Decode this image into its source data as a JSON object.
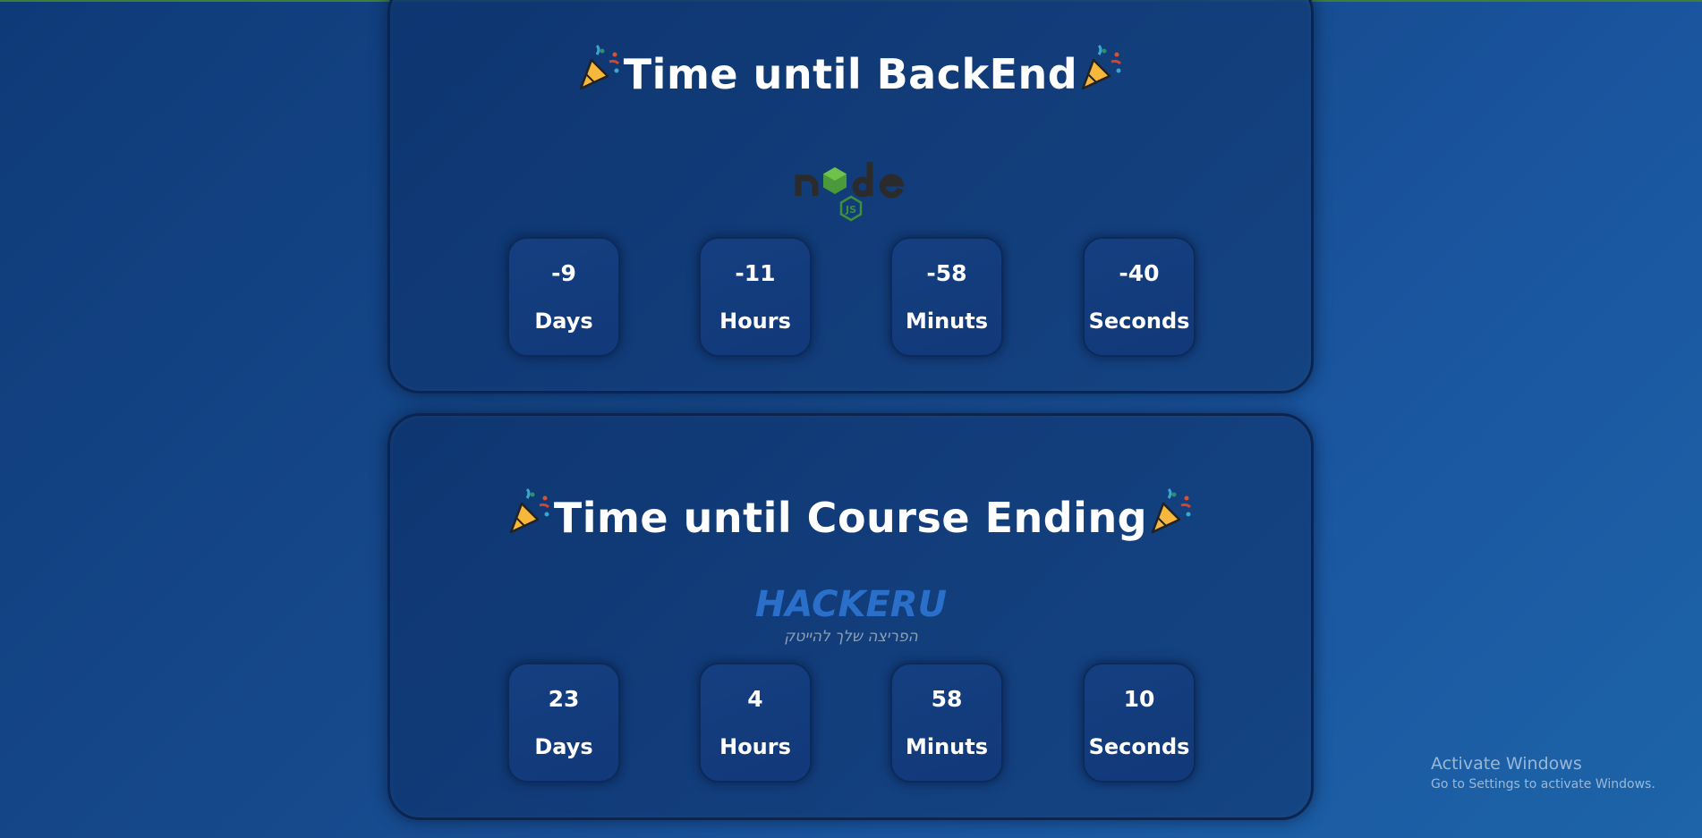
{
  "colors": {
    "background": "#164a8d",
    "card": "#0f3a78",
    "text": "#ffffff",
    "node_green": "#4a9a3c",
    "hackeru_blue": "#2a6fc9"
  },
  "cards": [
    {
      "title": "Time until BackEnd",
      "logo": "nodejs-logo",
      "counters": [
        {
          "value": "-9",
          "label": "Days"
        },
        {
          "value": "-11",
          "label": "Hours"
        },
        {
          "value": "-58",
          "label": "Minuts"
        },
        {
          "value": "-40",
          "label": "Seconds"
        }
      ]
    },
    {
      "title": "Time until Course Ending",
      "logo": "hackeru-logo",
      "logo_text": "HACKERU",
      "logo_tagline": "הפריצה שלך להייטק",
      "counters": [
        {
          "value": "23",
          "label": "Days"
        },
        {
          "value": "4",
          "label": "Hours"
        },
        {
          "value": "58",
          "label": "Minuts"
        },
        {
          "value": "10",
          "label": "Seconds"
        }
      ]
    }
  ],
  "icons": {
    "title_decoration": "party-popper-icon"
  },
  "os_watermark": {
    "title": "Activate Windows",
    "subtitle": "Go to Settings to activate Windows."
  }
}
